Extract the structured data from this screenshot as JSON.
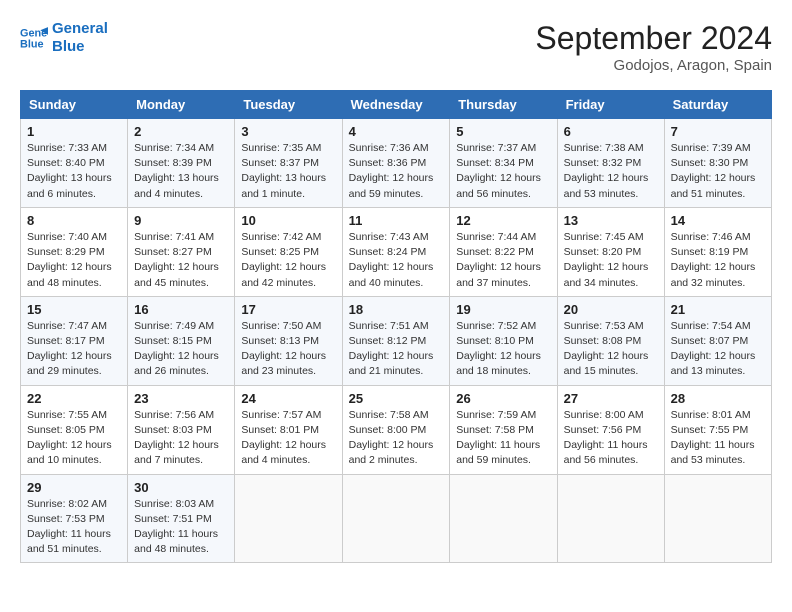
{
  "header": {
    "logo_line1": "General",
    "logo_line2": "Blue",
    "month": "September 2024",
    "location": "Godojos, Aragon, Spain"
  },
  "weekdays": [
    "Sunday",
    "Monday",
    "Tuesday",
    "Wednesday",
    "Thursday",
    "Friday",
    "Saturday"
  ],
  "weeks": [
    [
      {
        "day": "1",
        "info": "Sunrise: 7:33 AM\nSunset: 8:40 PM\nDaylight: 13 hours\nand 6 minutes."
      },
      {
        "day": "2",
        "info": "Sunrise: 7:34 AM\nSunset: 8:39 PM\nDaylight: 13 hours\nand 4 minutes."
      },
      {
        "day": "3",
        "info": "Sunrise: 7:35 AM\nSunset: 8:37 PM\nDaylight: 13 hours\nand 1 minute."
      },
      {
        "day": "4",
        "info": "Sunrise: 7:36 AM\nSunset: 8:36 PM\nDaylight: 12 hours\nand 59 minutes."
      },
      {
        "day": "5",
        "info": "Sunrise: 7:37 AM\nSunset: 8:34 PM\nDaylight: 12 hours\nand 56 minutes."
      },
      {
        "day": "6",
        "info": "Sunrise: 7:38 AM\nSunset: 8:32 PM\nDaylight: 12 hours\nand 53 minutes."
      },
      {
        "day": "7",
        "info": "Sunrise: 7:39 AM\nSunset: 8:30 PM\nDaylight: 12 hours\nand 51 minutes."
      }
    ],
    [
      {
        "day": "8",
        "info": "Sunrise: 7:40 AM\nSunset: 8:29 PM\nDaylight: 12 hours\nand 48 minutes."
      },
      {
        "day": "9",
        "info": "Sunrise: 7:41 AM\nSunset: 8:27 PM\nDaylight: 12 hours\nand 45 minutes."
      },
      {
        "day": "10",
        "info": "Sunrise: 7:42 AM\nSunset: 8:25 PM\nDaylight: 12 hours\nand 42 minutes."
      },
      {
        "day": "11",
        "info": "Sunrise: 7:43 AM\nSunset: 8:24 PM\nDaylight: 12 hours\nand 40 minutes."
      },
      {
        "day": "12",
        "info": "Sunrise: 7:44 AM\nSunset: 8:22 PM\nDaylight: 12 hours\nand 37 minutes."
      },
      {
        "day": "13",
        "info": "Sunrise: 7:45 AM\nSunset: 8:20 PM\nDaylight: 12 hours\nand 34 minutes."
      },
      {
        "day": "14",
        "info": "Sunrise: 7:46 AM\nSunset: 8:19 PM\nDaylight: 12 hours\nand 32 minutes."
      }
    ],
    [
      {
        "day": "15",
        "info": "Sunrise: 7:47 AM\nSunset: 8:17 PM\nDaylight: 12 hours\nand 29 minutes."
      },
      {
        "day": "16",
        "info": "Sunrise: 7:49 AM\nSunset: 8:15 PM\nDaylight: 12 hours\nand 26 minutes."
      },
      {
        "day": "17",
        "info": "Sunrise: 7:50 AM\nSunset: 8:13 PM\nDaylight: 12 hours\nand 23 minutes."
      },
      {
        "day": "18",
        "info": "Sunrise: 7:51 AM\nSunset: 8:12 PM\nDaylight: 12 hours\nand 21 minutes."
      },
      {
        "day": "19",
        "info": "Sunrise: 7:52 AM\nSunset: 8:10 PM\nDaylight: 12 hours\nand 18 minutes."
      },
      {
        "day": "20",
        "info": "Sunrise: 7:53 AM\nSunset: 8:08 PM\nDaylight: 12 hours\nand 15 minutes."
      },
      {
        "day": "21",
        "info": "Sunrise: 7:54 AM\nSunset: 8:07 PM\nDaylight: 12 hours\nand 13 minutes."
      }
    ],
    [
      {
        "day": "22",
        "info": "Sunrise: 7:55 AM\nSunset: 8:05 PM\nDaylight: 12 hours\nand 10 minutes."
      },
      {
        "day": "23",
        "info": "Sunrise: 7:56 AM\nSunset: 8:03 PM\nDaylight: 12 hours\nand 7 minutes."
      },
      {
        "day": "24",
        "info": "Sunrise: 7:57 AM\nSunset: 8:01 PM\nDaylight: 12 hours\nand 4 minutes."
      },
      {
        "day": "25",
        "info": "Sunrise: 7:58 AM\nSunset: 8:00 PM\nDaylight: 12 hours\nand 2 minutes."
      },
      {
        "day": "26",
        "info": "Sunrise: 7:59 AM\nSunset: 7:58 PM\nDaylight: 11 hours\nand 59 minutes."
      },
      {
        "day": "27",
        "info": "Sunrise: 8:00 AM\nSunset: 7:56 PM\nDaylight: 11 hours\nand 56 minutes."
      },
      {
        "day": "28",
        "info": "Sunrise: 8:01 AM\nSunset: 7:55 PM\nDaylight: 11 hours\nand 53 minutes."
      }
    ],
    [
      {
        "day": "29",
        "info": "Sunrise: 8:02 AM\nSunset: 7:53 PM\nDaylight: 11 hours\nand 51 minutes."
      },
      {
        "day": "30",
        "info": "Sunrise: 8:03 AM\nSunset: 7:51 PM\nDaylight: 11 hours\nand 48 minutes."
      },
      {
        "day": "",
        "info": ""
      },
      {
        "day": "",
        "info": ""
      },
      {
        "day": "",
        "info": ""
      },
      {
        "day": "",
        "info": ""
      },
      {
        "day": "",
        "info": ""
      }
    ]
  ]
}
